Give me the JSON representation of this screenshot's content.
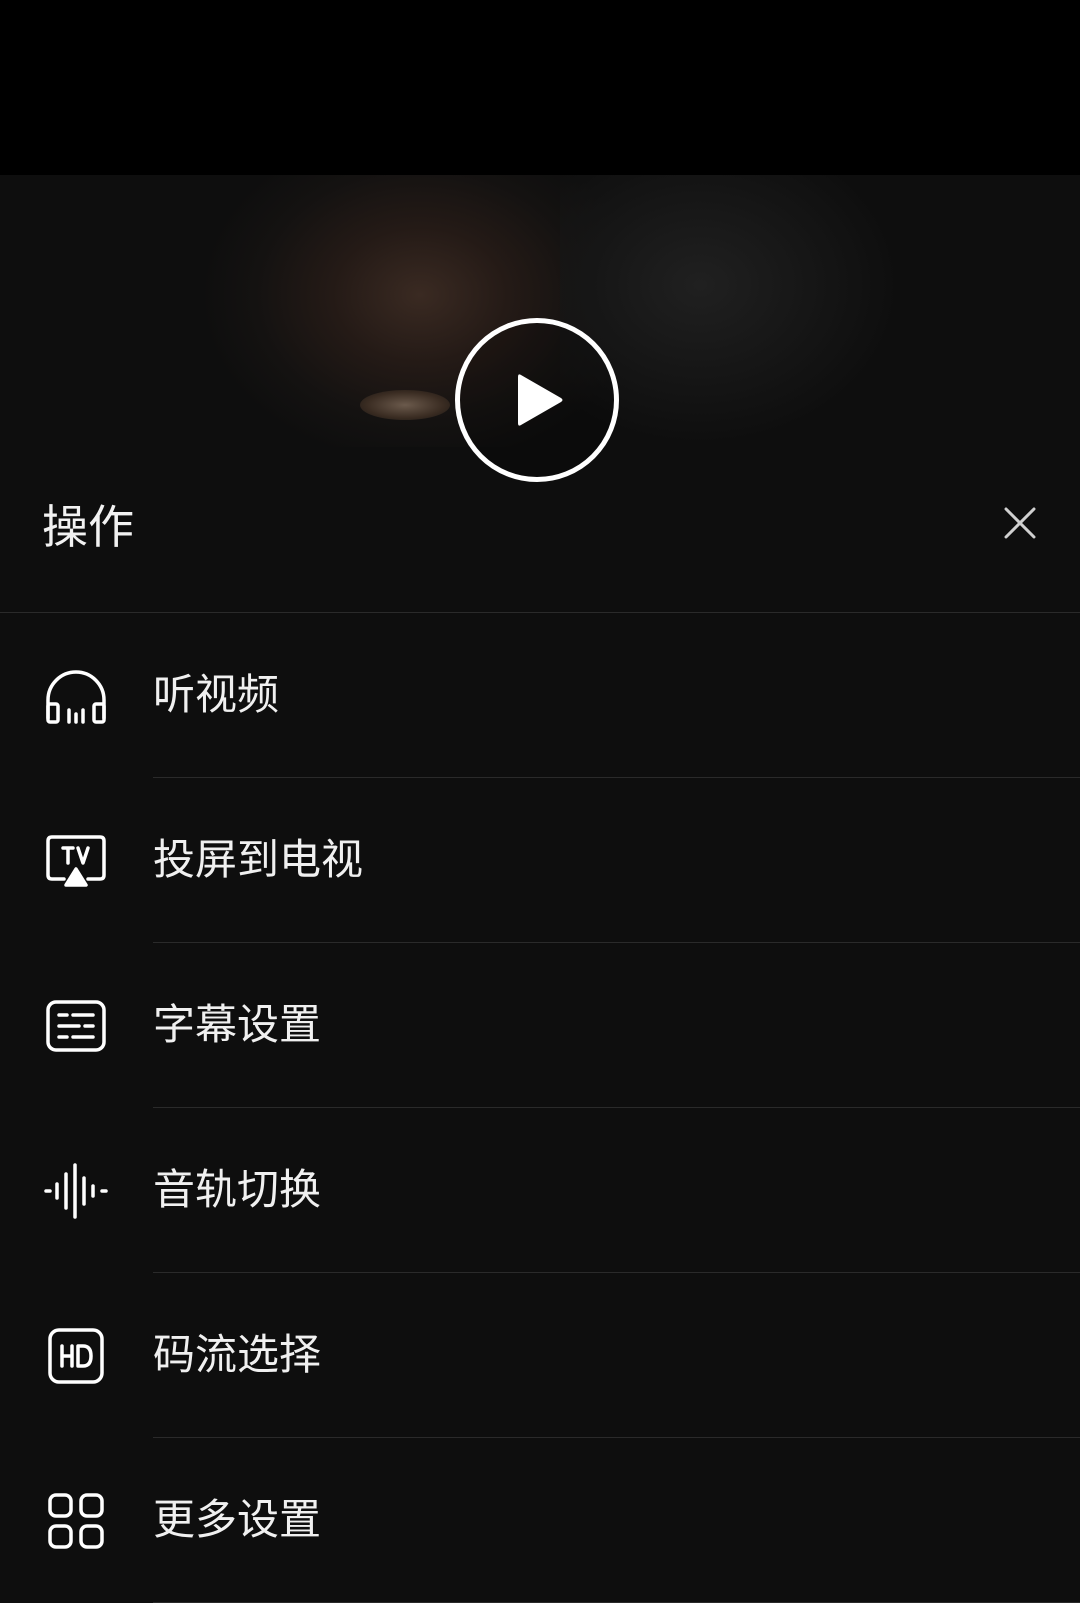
{
  "sheet": {
    "title": "操作",
    "close_icon": "close-icon"
  },
  "video": {
    "play_icon": "play-icon"
  },
  "menu": {
    "items": [
      {
        "label": "听视频",
        "icon": "headphones-icon"
      },
      {
        "label": "投屏到电视",
        "icon": "tv-cast-icon"
      },
      {
        "label": "字幕设置",
        "icon": "subtitles-icon"
      },
      {
        "label": "音轨切换",
        "icon": "audio-waveform-icon"
      },
      {
        "label": "码流选择",
        "icon": "hd-icon"
      },
      {
        "label": "更多设置",
        "icon": "grid-icon"
      }
    ]
  },
  "colors": {
    "sheet_background": "#0e0e0e",
    "text": "#f0f0f0",
    "divider": "#2a2a2a"
  }
}
